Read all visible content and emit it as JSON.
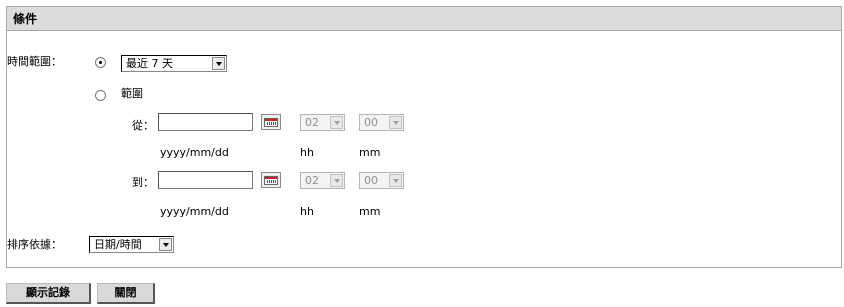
{
  "panel": {
    "title": "條件"
  },
  "time_range": {
    "label": "時間範圍：",
    "preset_option_selected": true,
    "preset_value": "最近 7 天",
    "range_label": "範圍",
    "from_label": "從：",
    "to_label": "到：",
    "from_date": "",
    "to_date": "",
    "from_hour": "02",
    "from_minute": "00",
    "to_hour": "02",
    "to_minute": "00",
    "date_hint": "yyyy/mm/dd",
    "hour_hint": "hh",
    "minute_hint": "mm"
  },
  "sort": {
    "label": "排序依據：",
    "value": "日期/時間"
  },
  "buttons": {
    "show": "顯示記錄",
    "close": "關閉"
  }
}
